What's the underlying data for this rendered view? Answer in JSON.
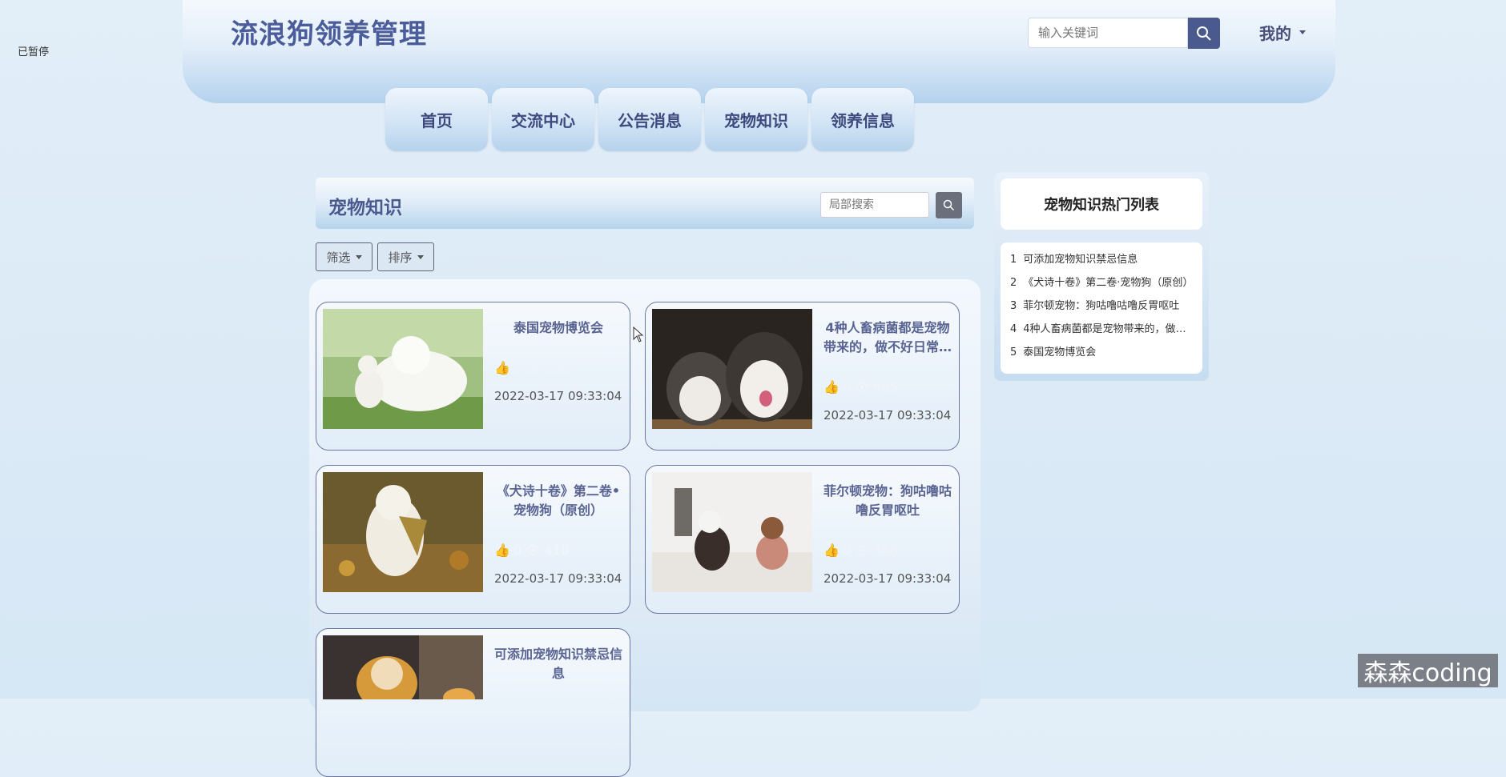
{
  "status": {
    "paused": "已暂停"
  },
  "header": {
    "title": "流浪狗领养管理",
    "search_placeholder": "输入关键词",
    "my_menu": "我的"
  },
  "nav": [
    "首页",
    "交流中心",
    "公告消息",
    "宠物知识",
    "领养信息"
  ],
  "section": {
    "title": "宠物知识",
    "search_placeholder": "局部搜索",
    "filter_label": "筛选",
    "sort_label": "排序"
  },
  "cards": [
    {
      "title": "泰国宠物博览会",
      "likes": "0",
      "views": "739",
      "date": "2022-03-17 09:33:04"
    },
    {
      "title": "4种人畜病菌都是宠物带来的，做不好日常…",
      "likes": "0",
      "views": "605",
      "date": "2022-03-17 09:33:04"
    },
    {
      "title": "《犬诗十卷》第二卷•宠物狗（原创）",
      "likes": "0",
      "views": "418",
      "date": "2022-03-17 09:33:04"
    },
    {
      "title": "菲尔顿宠物：狗咕噜咕噜反胃呕吐",
      "likes": "0",
      "views": "558",
      "date": "2022-03-17 09:33:04"
    },
    {
      "title": "可添加宠物知识禁忌信息",
      "likes": "",
      "views": "",
      "date": ""
    }
  ],
  "hot_list": {
    "title": "宠物知识热门列表",
    "items": [
      {
        "num": "1",
        "text": "可添加宠物知识禁忌信息"
      },
      {
        "num": "2",
        "text": "《犬诗十卷》第二卷·宠物狗（原创）"
      },
      {
        "num": "3",
        "text": "菲尔顿宠物：狗咕噜咕噜反胃呕吐"
      },
      {
        "num": "4",
        "text": "4种人畜病菌都是宠物带来的，做不好日常…"
      },
      {
        "num": "5",
        "text": "泰国宠物博览会"
      }
    ]
  },
  "watermark": "森森coding",
  "colors": {
    "accent": "#4a5a8f",
    "title": "#4a5c9a",
    "card_border": "#6b78a6"
  }
}
